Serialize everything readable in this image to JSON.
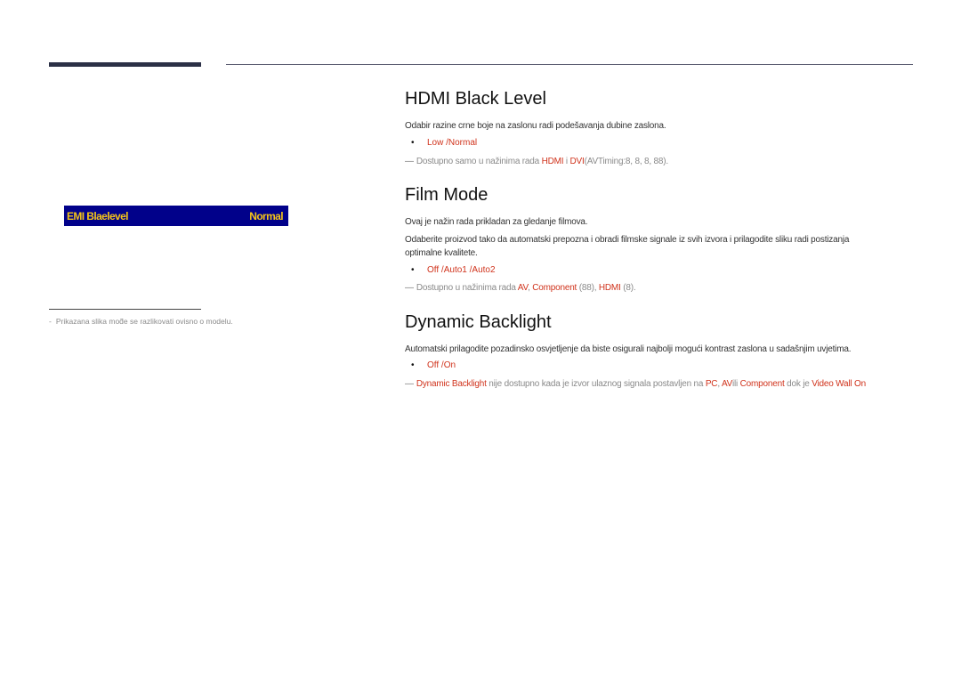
{
  "sidebar": {
    "menu_preview": {
      "label": "EMI Blaelevel",
      "value": "Normal"
    },
    "footnote": "Prikazana slika moƌe se razlikovati ovisno o modelu."
  },
  "sections": [
    {
      "title": "HDMI Black Level",
      "paragraphs": [
        "Odabir razine crne boje na zaslonu radi podešavanja dubine zaslona."
      ],
      "options": "Low /Normal",
      "note": {
        "prefix": "Dostupno samo u nažinima rada ",
        "hl1": "HDMI",
        "mid": " i ",
        "hl2": "DVI",
        "suffix": "(AVTiming:8, 8, 8, 88)."
      }
    },
    {
      "title": "Film Mode",
      "paragraphs": [
        "Ovaj je nažin rada prikladan za gledanje filmova.",
        "Odaberite proizvod tako da automatski prepozna i obradi filmske signale iz svih izvora i prilagodite sliku radi postizanja",
        "optimalne kvalitete."
      ],
      "options": "Off /Auto1 /Auto2",
      "note": {
        "prefix": "Dostupno u nažinima rada ",
        "hl1": "AV",
        "mid": ", ",
        "hl2": "Component",
        "mid2": " (88), ",
        "hl3": "HDMI",
        "suffix": " (8)."
      }
    },
    {
      "title": "Dynamic Backlight",
      "paragraphs": [
        "Automatski prilagodite pozadinsko osvjetljenje da biste osigurali najbolji mogući kontrast zaslona u sadašnjim uvjetima."
      ],
      "options": "Off /On",
      "note": {
        "hl1": "Dynamic Backlight",
        "mid": " nije dostupno kada je izvor ulaznog signala postavljen na ",
        "hl2": "PC",
        "mid2": ", ",
        "hl3": "AV",
        "mid3": "ili ",
        "hl4": "Component",
        "mid4": " dok je ",
        "hl5": "Video Wall On"
      }
    }
  ],
  "colors": {
    "accent": "#d0331c",
    "menu_bg": "#01018a",
    "menu_text": "#f5c518"
  }
}
